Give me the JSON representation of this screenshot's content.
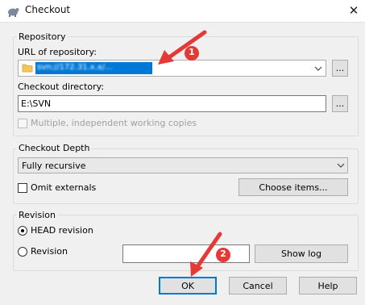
{
  "window": {
    "title": "Checkout",
    "close_glyph": "✕"
  },
  "repository": {
    "group_title": "Repository",
    "url_label": "URL of repository:",
    "url_value": "svn://172.31.x.x/...",
    "url_browse": "...",
    "checkout_dir_label": "Checkout directory:",
    "checkout_dir_value": "E:\\SVN",
    "checkout_dir_browse": "...",
    "multiple_wc_label": "Multiple, independent working copies"
  },
  "depth": {
    "group_title": "Checkout Depth",
    "selected": "Fully recursive",
    "omit_externals_label": "Omit externals",
    "choose_items_label": "Choose items..."
  },
  "revision": {
    "group_title": "Revision",
    "head_label": "HEAD revision",
    "revision_label": "Revision",
    "revision_value": "",
    "show_log_label": "Show log"
  },
  "buttons": {
    "ok": "OK",
    "cancel": "Cancel",
    "help": "Help"
  },
  "annotations": {
    "marker1": "1",
    "marker2": "2",
    "color": "#e53935"
  },
  "colors": {
    "accent": "#0078d7",
    "selection": "#0078d7",
    "folder": "#f5c55a"
  }
}
